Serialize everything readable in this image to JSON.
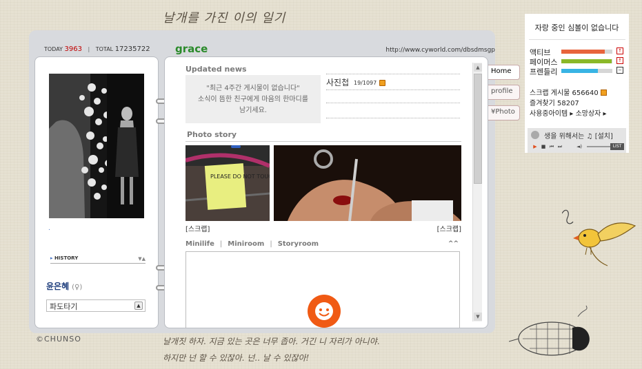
{
  "decor": {
    "top_handwriting": "날개를 가진 이의 일기",
    "bottom_handwriting_1": "날개짓 하자. 지금 있는 곳은 너무 좁아. 거긴 니 자리가 아니야.",
    "bottom_handwriting_2": "하지만 넌 할 수 있잖아. 넌.. 날 수 있잖아!",
    "credit": "©CHUNSO"
  },
  "header": {
    "today_label": "TODAY",
    "today_count": "3963",
    "total_label": "TOTAL",
    "total_count": "17235722",
    "title": "grace",
    "url": "http://www.cyworld.com/dbsdmsgp"
  },
  "left": {
    "dot": ".",
    "history_label": "HISTORY",
    "history_toggle": "▼▲",
    "owner_name": "윤은혜",
    "gender": "(♀)",
    "mood": "파도타기",
    "mood_button": "▲"
  },
  "main": {
    "updated_news_title": "Updated news",
    "news_lines": [
      "\"최근 4주간 게시물이 없습니다\"",
      "소식이 뜸한 친구에게 마음의 한마디를",
      "남기세요."
    ],
    "album_label": "사진첩",
    "album_count": "19/1097",
    "photo_story_title": "Photo story",
    "photo_sign_text": "PLEASE DO NOT TOUCH!!",
    "scrap_left": "[스크랩]",
    "scrap_right": "[스크랩]",
    "tabs": [
      "Minilife",
      "Miniroom",
      "Storyroom"
    ],
    "collapse": "^^",
    "scroll_up": "▲",
    "scroll_down": "▼"
  },
  "side_tabs": [
    "Home",
    "profile",
    "¥Photo"
  ],
  "widget": {
    "status": "자랑 중인 심볼이 없습니다",
    "stats": [
      {
        "label": "액티브",
        "value": 0.85,
        "color": "#e8643c",
        "arrow": "↑"
      },
      {
        "label": "페이머스",
        "value": 0.98,
        "color": "#8ab828",
        "arrow": "↑"
      },
      {
        "label": "프렌들리",
        "value": 0.72,
        "color": "#38b4e4",
        "arrow": "−"
      }
    ],
    "scrap_posts": "스크랩 게시물 656640",
    "favorites": "즐겨찾기 58207",
    "items": "사용중아이템 ▸ 소망상자 ▸",
    "music_title": "생을 위해서는 ♫ [설치]",
    "list_label": "LIST"
  }
}
